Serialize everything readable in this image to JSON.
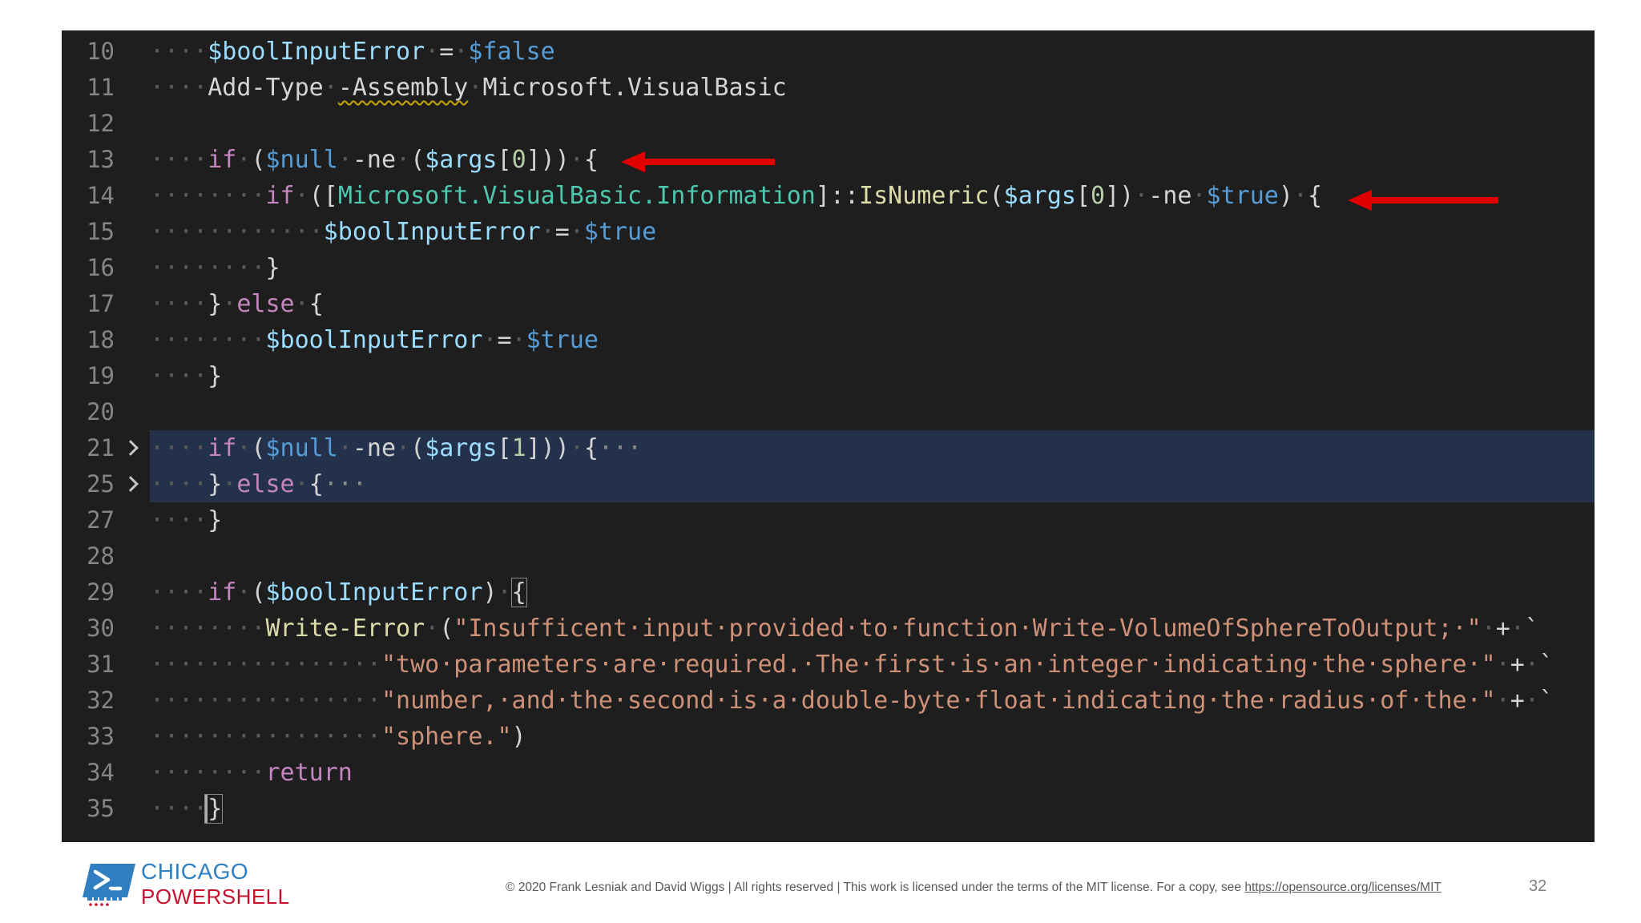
{
  "editor": {
    "lines": [
      {
        "n": "10",
        "indent": "····",
        "html": "<span style=\"color:#9cdcfe\">$boolInputError</span><span class=\"ind\">·</span>=<span class=\"ind\">·</span><span style=\"color:#569cd6\">$false</span>"
      },
      {
        "n": "11",
        "indent": "····",
        "html": "Add-Type<span class=\"ind\">·</span><span class=\"squig\">-Assembly</span><span class=\"ind\">·</span>Microsoft.VisualBasic"
      },
      {
        "n": "12",
        "indent": "",
        "html": ""
      },
      {
        "n": "13",
        "indent": "····",
        "html": "<span style=\"color:#c586c0\">if</span><span class=\"ind\">·</span>(<span style=\"color:#569cd6\">$null</span><span class=\"ind\">·</span>-ne<span class=\"ind\">·</span>(<span style=\"color:#9cdcfe\">$args</span>[<span style=\"color:#b5cea8\">0</span>]))<span class=\"ind\">·</span>{"
      },
      {
        "n": "14",
        "indent": "········",
        "html": "<span style=\"color:#c586c0\">if</span><span class=\"ind\">·</span>([<span style=\"color:#4ec9b0\">Microsoft.VisualBasic.Information</span>]::<span style=\"color:#dcdcaa\">IsNumeric</span>(<span style=\"color:#9cdcfe\">$args</span>[<span style=\"color:#b5cea8\">0</span>])<span class=\"ind\">·</span>-ne<span class=\"ind\">·</span><span style=\"color:#569cd6\">$true</span>)<span class=\"ind\">·</span>{"
      },
      {
        "n": "15",
        "indent": "············",
        "html": "<span style=\"color:#9cdcfe\">$boolInputError</span><span class=\"ind\">·</span>=<span class=\"ind\">·</span><span style=\"color:#569cd6\">$true</span>"
      },
      {
        "n": "16",
        "indent": "········",
        "html": "}"
      },
      {
        "n": "17",
        "indent": "····",
        "html": "}<span class=\"ind\">·</span><span style=\"color:#c586c0\">else</span><span class=\"ind\">·</span>{"
      },
      {
        "n": "18",
        "indent": "········",
        "html": "<span style=\"color:#9cdcfe\">$boolInputError</span><span class=\"ind\">·</span>=<span class=\"ind\">·</span><span style=\"color:#569cd6\">$true</span>"
      },
      {
        "n": "19",
        "indent": "····",
        "html": "}"
      },
      {
        "n": "20",
        "indent": "",
        "html": ""
      },
      {
        "n": "21",
        "indent": "····",
        "fold": true,
        "html": "<span style=\"color:#c586c0\">if</span><span class=\"ind\">·</span>(<span style=\"color:#569cd6\">$null</span><span class=\"ind\">·</span>-ne<span class=\"ind\">·</span>(<span style=\"color:#9cdcfe\">$args</span>[<span style=\"color:#b5cea8\">1</span>]))<span class=\"ind\">·</span>{<span style=\"color:#8a8a8a\">···</span>"
      },
      {
        "n": "25",
        "indent": "····",
        "fold": true,
        "html": "}<span class=\"ind\">·</span><span style=\"color:#c586c0\">else</span><span class=\"ind\">·</span>{<span style=\"color:#8a8a8a\">···</span>"
      },
      {
        "n": "27",
        "indent": "····",
        "html": "}"
      },
      {
        "n": "28",
        "indent": "",
        "html": ""
      },
      {
        "n": "29",
        "indent": "····",
        "html": "<span style=\"color:#c586c0\">if</span><span class=\"ind\">·</span>(<span style=\"color:#9cdcfe\">$boolInputError</span>)<span class=\"ind\">·</span><span class=\"bm\">{</span>"
      },
      {
        "n": "30",
        "indent": "········",
        "html": "<span style=\"color:#dcdcaa\">Write-Error</span><span class=\"ind\">·</span>(<span style=\"color:#ce9178\">\"Insufficent·input·provided·to·function·Write-VolumeOfSphereToOutput;·\"</span><span class=\"ind\">·</span>+<span class=\"ind\">·</span>`"
      },
      {
        "n": "31",
        "indent": "················",
        "html": "<span style=\"color:#ce9178\">\"two·parameters·are·required.·The·first·is·an·integer·indicating·the·sphere·\"</span><span class=\"ind\">·</span>+<span class=\"ind\">·</span>`"
      },
      {
        "n": "32",
        "indent": "················",
        "html": "<span style=\"color:#ce9178\">\"number,·and·the·second·is·a·double-byte·float·indicating·the·radius·of·the·\"</span><span class=\"ind\">·</span>+<span class=\"ind\">·</span>`"
      },
      {
        "n": "33",
        "indent": "················",
        "html": "<span style=\"color:#ce9178\">\"sphere.\"</span>)"
      },
      {
        "n": "34",
        "indent": "········",
        "html": "<span style=\"color:#c586c0\">return</span>"
      },
      {
        "n": "35",
        "indent": "····",
        "html": "<span class=\"bm cur\">}</span>"
      }
    ]
  },
  "footer": {
    "logo_line1": "CHICAGO",
    "logo_line2": "POWERSHELL",
    "copyright_text": "© 2020 Frank Lesniak and David Wiggs | All rights reserved | This work is licensed under the terms of the MIT license. For a copy, see ",
    "license_link": "https://opensource.org/licenses/MIT",
    "page_number": "32"
  },
  "colors": {
    "editor_bg": "#1e1e1e",
    "arrow": "#e00000",
    "logo_blue": "#2f7fc1",
    "logo_red": "#c8102e"
  }
}
